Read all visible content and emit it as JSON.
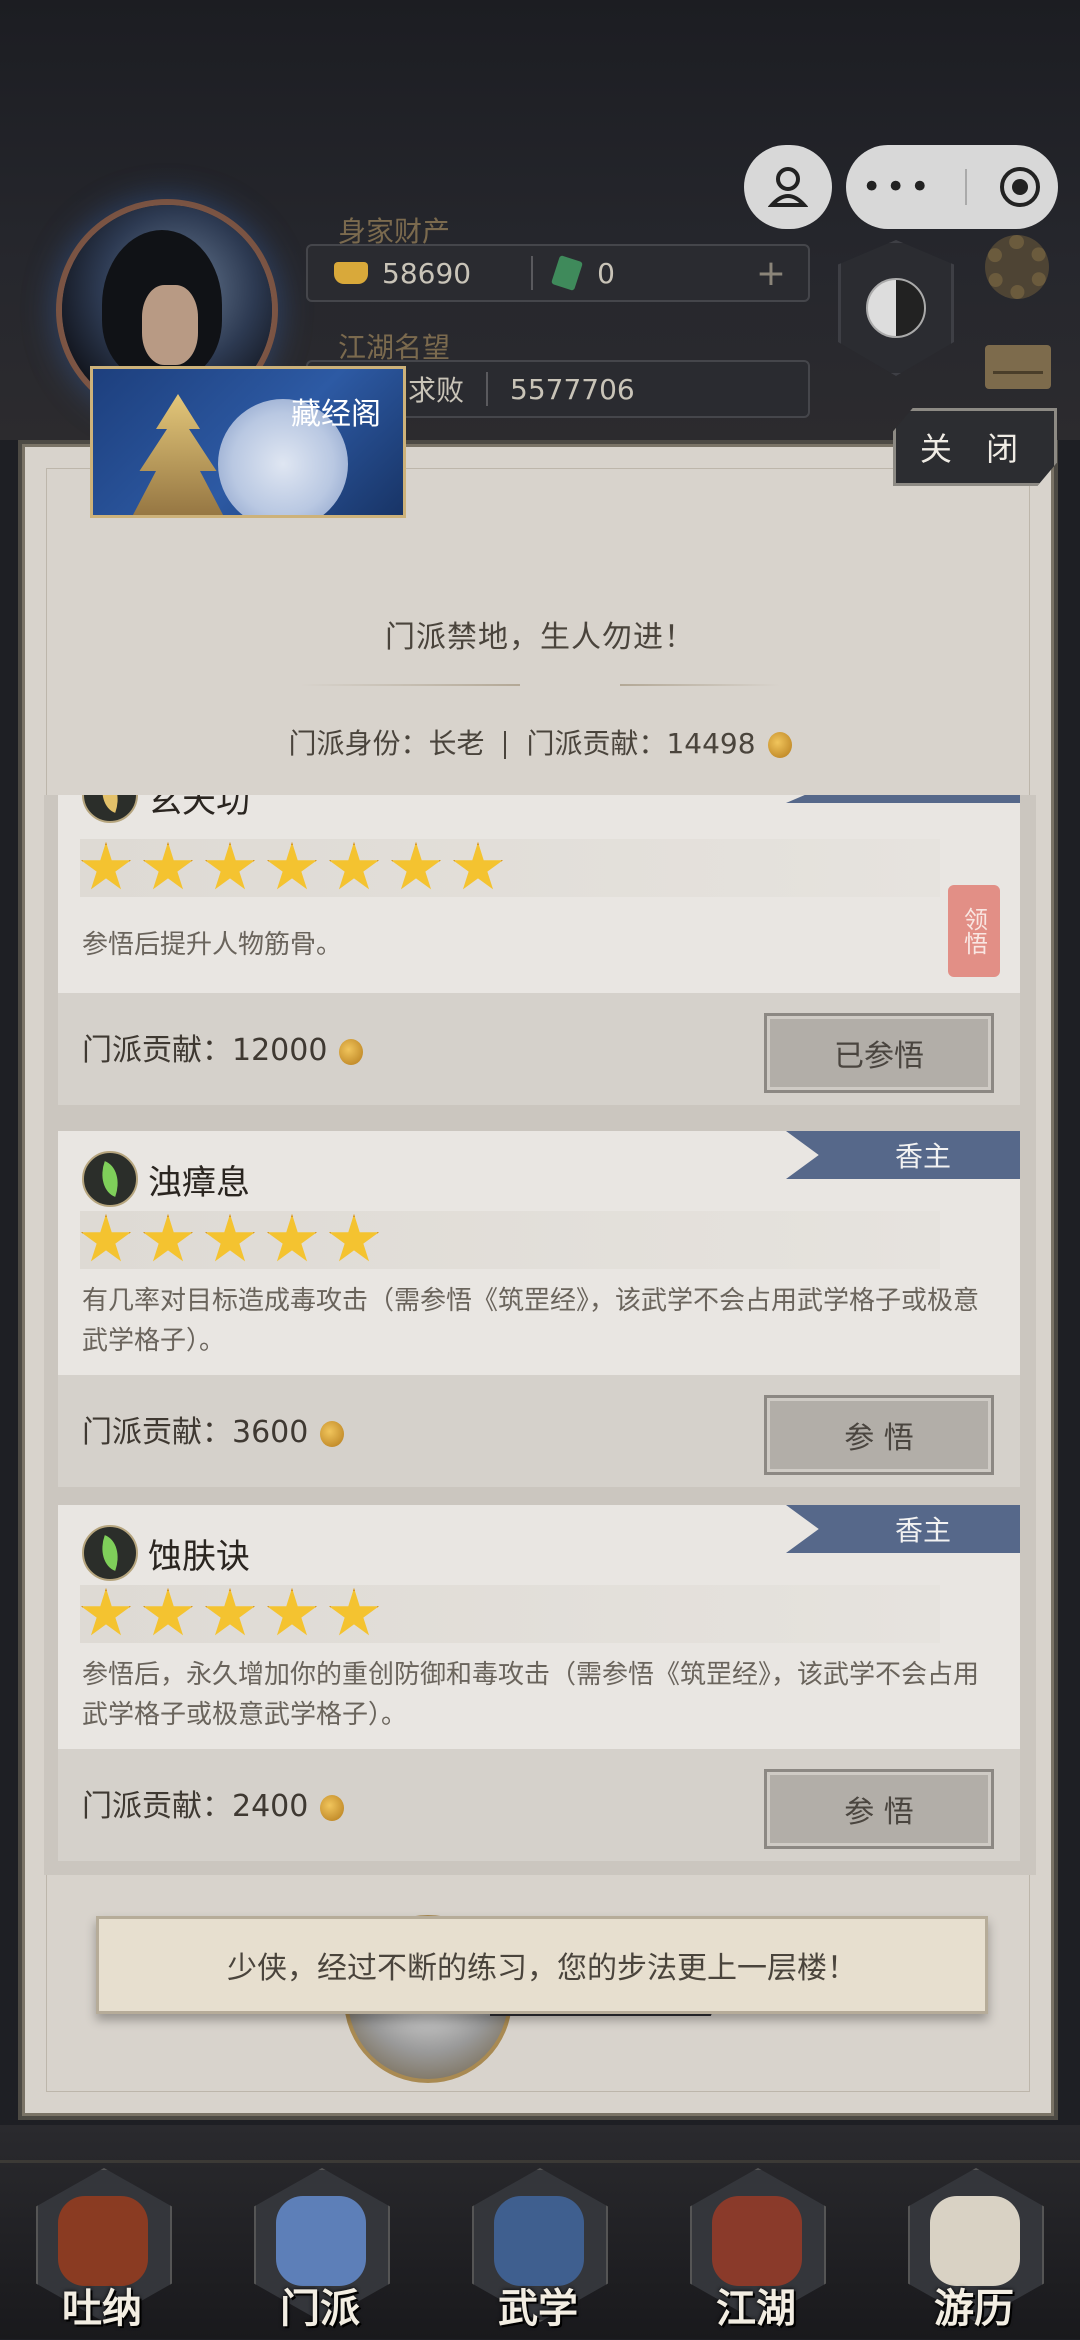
{
  "hud": {
    "wealth_label": "身家财产",
    "gold": "58690",
    "jade": "0",
    "fame_label": "江湖名望",
    "fame_title": "求败",
    "fame_value": "5577706"
  },
  "panel": {
    "scene_title": "藏经阁",
    "close_label": "关 闭",
    "motto": "门派禁地，生人勿进！",
    "identity_label": "门派身份：长老",
    "contribution_label": "门派贡献：14498"
  },
  "skills": [
    {
      "name": "玄天功",
      "stars": 7,
      "description": "参悟后提升人物筋骨。",
      "cost_label": "门派贡献：12000",
      "button": "已参悟",
      "seal": "领悟"
    },
    {
      "name": "浊瘴息",
      "rank": "香主",
      "stars": 5,
      "description": "有几率对目标造成毒攻击（需参悟《筑罡经》，该武学不会占用武学格子或极意武学格子）。",
      "cost_label": "门派贡献：3600",
      "button": "参  悟"
    },
    {
      "name": "蚀肤诀",
      "rank": "香主",
      "stars": 5,
      "description": "参悟后，永久增加你的重创防御和毒攻击（需参悟《筑罡经》，该武学不会占用武学格子或极意武学格子）。",
      "cost_label": "门派贡献：2400",
      "button": "参  悟"
    }
  ],
  "toast": "少侠，经过不断的练习，您的步法更上一层楼！",
  "nav": [
    {
      "label": "吐纳",
      "icon": "meditation-icon"
    },
    {
      "label": "门派",
      "icon": "sect-flag-icon"
    },
    {
      "label": "武学",
      "icon": "scroll-book-icon"
    },
    {
      "label": "江湖",
      "icon": "bamboo-hat-icon"
    },
    {
      "label": "游历",
      "icon": "horse-icon"
    }
  ],
  "colors": {
    "rank_tag": "#56688a",
    "gold": "#f4c330",
    "panel": "#d8d3cc"
  }
}
